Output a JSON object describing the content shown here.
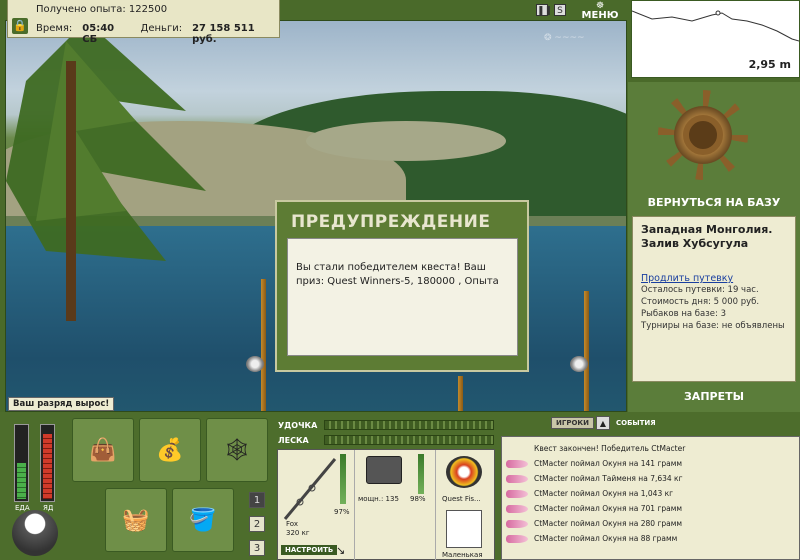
{
  "top_info": {
    "experience_label": "Получено опыта:",
    "experience_value": "122500",
    "time_label": "Время:",
    "time_value": "05:40 СБ",
    "money_label": "Деньги:",
    "money_value": "27 158 511 руб."
  },
  "header": {
    "menu_label": "МЕНЮ",
    "pause_icon": "pause-icon",
    "sound_icon": "sound-icon"
  },
  "depth": {
    "value": "2,95 m"
  },
  "right_panel": {
    "back_to_base": "ВЕРНУТЬСЯ НА БАЗУ",
    "location_title": "Западная Монголия. Залив Хубсугула",
    "extend_trip_link": "Продлить путевку",
    "trip_left": "Осталось путевки: 19 час.",
    "trip_cost": "Стоимость дня: 5 000 руб.",
    "fishers_on_base": "Рыбаков на базе: 3",
    "tournaments": "Турниры на базе: не объявлены",
    "bans_label": "ЗАПРЕТЫ"
  },
  "dialog": {
    "title": "ПРЕДУПРЕЖДЕНИЕ",
    "message": "Вы стали победителем квеста! Ваш приз: Quest Winners-5, 180000 , Опыта"
  },
  "rank_message": "Ваш разряд вырос!",
  "meters": {
    "food_label": "ЕДА",
    "poison_label": "ЯД",
    "food_level": 0.5,
    "poison_level": 0.9
  },
  "inventory": {
    "page_buttons": [
      "1",
      "2",
      "3"
    ],
    "active_page": "1"
  },
  "tackle": {
    "rod_label": "УДОЧКА",
    "line_label": "ЛЕСКА",
    "rod_name": "Fox",
    "rod_weight": "320 кг",
    "rod_percent": "97%",
    "reel_power": "мощн.: 135",
    "reel_percent": "98%",
    "line_name": "Quest Fis...",
    "lure_name": "Маленькая",
    "tune_button": "НАСТРОИТЬ"
  },
  "events": {
    "tab_games": "ИГРОКИ",
    "tab_events": "СОБЫТИЯ",
    "items": [
      {
        "text": "Квест закончен! Победитель CtMacter",
        "fish": false
      },
      {
        "text": "CtMacter поймал Окуня на 141 грамм",
        "fish": true
      },
      {
        "text": "CtMacter поймал Тайменя на 7,634 кг",
        "fish": true
      },
      {
        "text": "CtMacter поймал Окуня на 1,043 кг",
        "fish": true
      },
      {
        "text": "CtMacter поймал Окуня на 701 грамм",
        "fish": true
      },
      {
        "text": "CtMacter поймал Окуня на 280 грамм",
        "fish": true
      },
      {
        "text": "CtMacter поймал Окуня на 88 грамм",
        "fish": true
      }
    ]
  }
}
